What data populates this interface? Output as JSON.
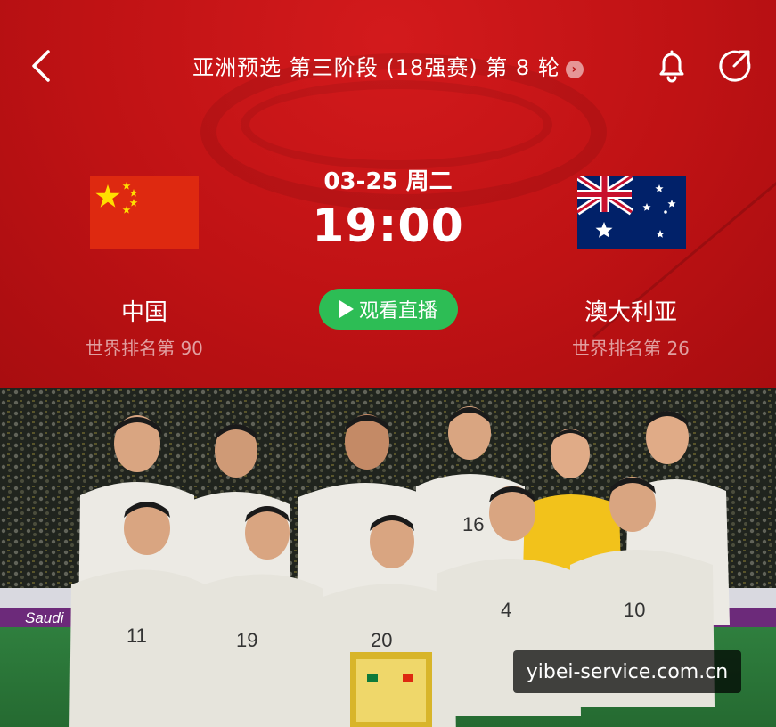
{
  "header": {
    "title": "亚洲预选 第三阶段 (18强赛) 第 8 轮",
    "more_glyph": "›"
  },
  "match": {
    "date": "03-25 周二",
    "time": "19:00",
    "watch_label": "观看直播"
  },
  "home_team": {
    "name": "中国",
    "rank": "世界排名第 90"
  },
  "away_team": {
    "name": "澳大利亚",
    "rank": "世界排名第 26"
  },
  "photo": {
    "ad_board_text": "Saudi",
    "caption": "yibei-service.com.cn",
    "jersey_numbers": [
      "16",
      "11",
      "19",
      "20",
      "4",
      "10"
    ]
  },
  "icons": {
    "back": "back-icon",
    "bell": "bell-icon",
    "share": "share-icon",
    "play": "play-icon"
  },
  "colors": {
    "header_red": "#c41416",
    "watch_green": "#2dbd55",
    "flag_cn": "#de2910",
    "flag_au": "#012169"
  }
}
